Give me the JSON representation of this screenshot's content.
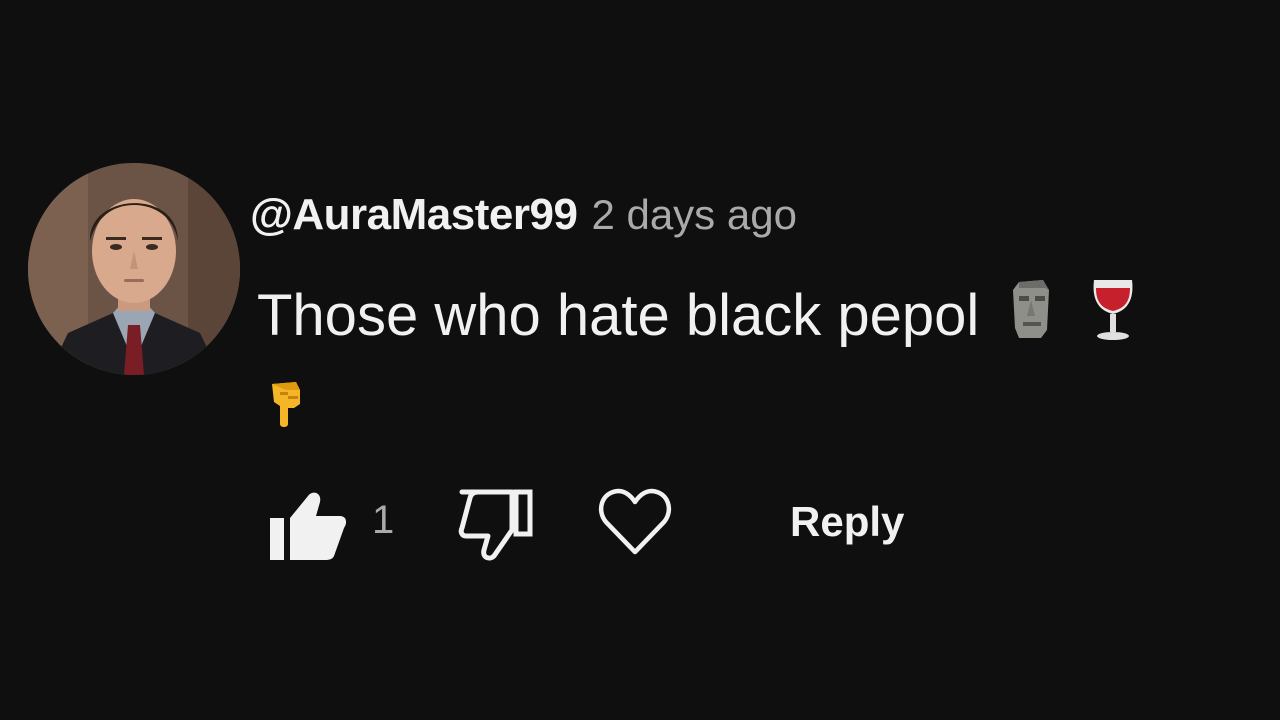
{
  "comment": {
    "author": "@AuraMaster99",
    "timestamp": "2 days ago",
    "text": "Those who hate black pepol",
    "emojis": [
      "moai-emoji",
      "wine-glass-emoji",
      "pointing-down-emoji"
    ],
    "like_count": "1",
    "reply_label": "Reply"
  },
  "colors": {
    "background": "#0f0f0f",
    "primary_text": "#f1f1f1",
    "secondary_text": "#aaaaaa"
  }
}
